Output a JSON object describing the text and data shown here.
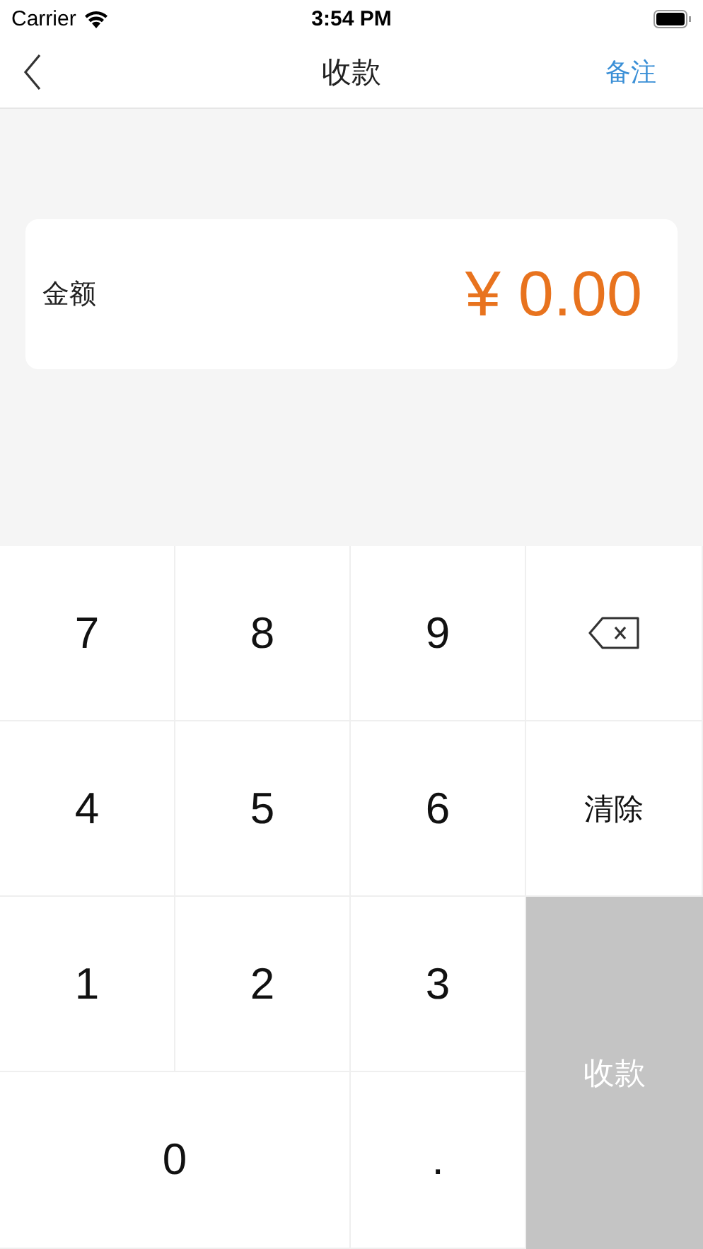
{
  "status_bar": {
    "carrier": "Carrier",
    "time": "3:54 PM"
  },
  "nav": {
    "title": "收款",
    "action": "备注"
  },
  "amount_card": {
    "label": "金额",
    "value": "¥ 0.00"
  },
  "keypad": [
    {
      "kind": "digit",
      "label": "7"
    },
    {
      "kind": "digit",
      "label": "8"
    },
    {
      "kind": "digit",
      "label": "9"
    },
    {
      "kind": "backspace"
    },
    {
      "kind": "digit",
      "label": "4"
    },
    {
      "kind": "digit",
      "label": "5"
    },
    {
      "kind": "digit",
      "label": "6"
    },
    {
      "kind": "clear",
      "label": "清除"
    },
    {
      "kind": "digit",
      "label": "1"
    },
    {
      "kind": "digit",
      "label": "2"
    },
    {
      "kind": "digit",
      "label": "3"
    },
    {
      "kind": "submit",
      "label": "收款",
      "disabled": true
    },
    {
      "kind": "wide-digit",
      "label": "0"
    },
    {
      "kind": "digit",
      "label": "."
    }
  ]
}
